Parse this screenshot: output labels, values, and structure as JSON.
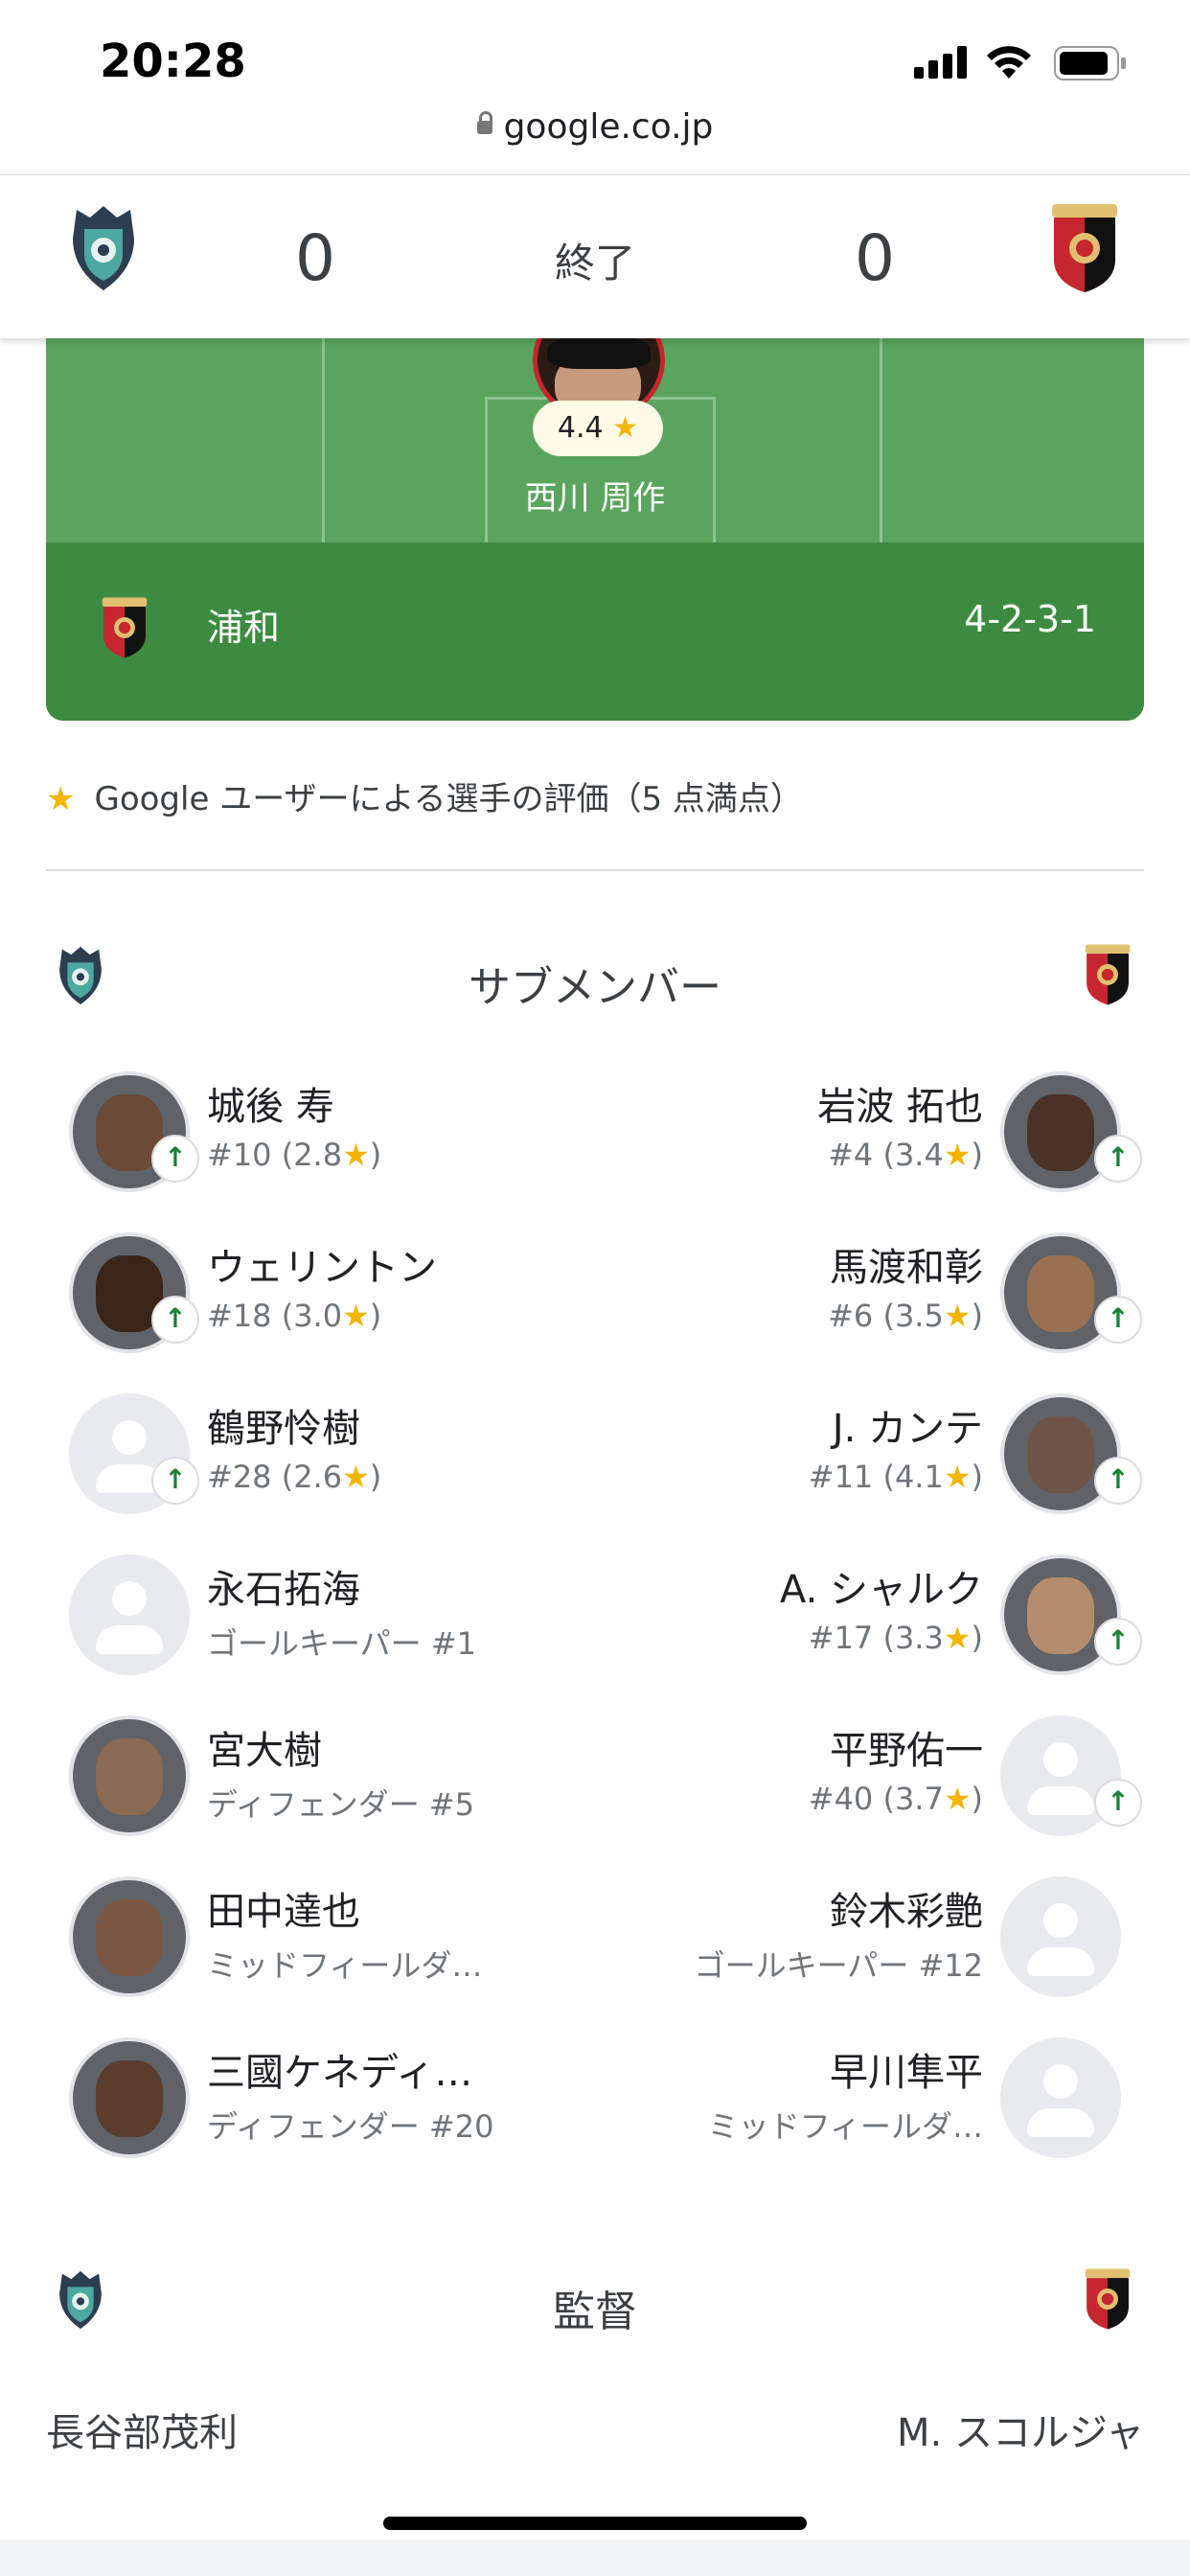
{
  "status_bar": {
    "time": "20:28"
  },
  "browser": {
    "url": "google.co.jp"
  },
  "match": {
    "home_score": "0",
    "away_score": "0",
    "status": "終了"
  },
  "lineup": {
    "team": "浦和",
    "formation": "4-2-3-1",
    "featured_player": {
      "rating": "4.4",
      "name": "西川 周作"
    }
  },
  "rating_note": {
    "star": "★",
    "text": "Google ユーザーによる選手の評価（5 点満点）"
  },
  "subs": {
    "title": "サブメンバー",
    "home": [
      {
        "name": "城後 寿",
        "info": "#10 (2.8★)",
        "subbed_in": true,
        "photo": true
      },
      {
        "name": "ウェリントン",
        "info": "#18 (3.0★)",
        "subbed_in": true,
        "photo": true
      },
      {
        "name": "鶴野怜樹",
        "info": "#28 (2.6★)",
        "subbed_in": true,
        "photo": false
      },
      {
        "name": "永石拓海",
        "info": "ゴールキーパー  #1",
        "subbed_in": false,
        "photo": false
      },
      {
        "name": "宮大樹",
        "info": "ディフェンダー  #5",
        "subbed_in": false,
        "photo": true
      },
      {
        "name": "田中達也",
        "info": "ミッドフィールダ…",
        "subbed_in": false,
        "photo": true
      },
      {
        "name": "三國ケネディ…",
        "info": "ディフェンダー  #20",
        "subbed_in": false,
        "photo": true
      }
    ],
    "away": [
      {
        "name": "岩波 拓也",
        "info": "#4 (3.4★)",
        "subbed_in": true,
        "photo": true
      },
      {
        "name": "馬渡和彰",
        "info": "#6 (3.5★)",
        "subbed_in": true,
        "photo": true
      },
      {
        "name": "J. カンテ",
        "info": "#11 (4.1★)",
        "subbed_in": true,
        "photo": true
      },
      {
        "name": "A. シャルク",
        "info": "#17 (3.3★)",
        "subbed_in": true,
        "photo": true
      },
      {
        "name": "平野佑一",
        "info": "#40 (3.7★)",
        "subbed_in": true,
        "photo": false
      },
      {
        "name": "鈴木彩艶",
        "info": "ゴールキーパー  #12",
        "subbed_in": false,
        "photo": false
      },
      {
        "name": "早川隼平",
        "info": "ミッドフィールダ…",
        "subbed_in": false,
        "photo": false
      }
    ]
  },
  "managers": {
    "title": "監督",
    "home": "長谷部茂利",
    "away": "M. スコルジャ"
  },
  "colors": {
    "field": "#5aa55d",
    "field_dark": "#3d8b41",
    "star": "#f4b400",
    "sub_arrow": "#188038"
  },
  "icons": {
    "sub_in": "↑"
  }
}
